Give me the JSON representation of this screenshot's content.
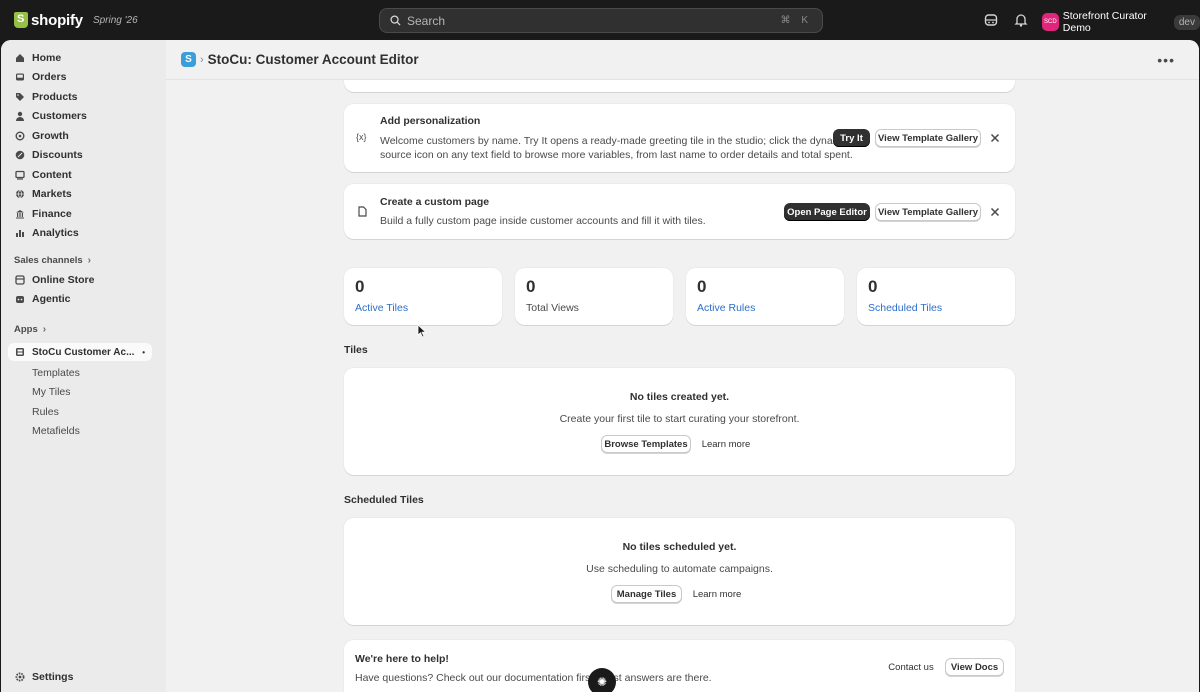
{
  "topbar": {
    "brand": "shopify",
    "version": "Spring '26",
    "search_placeholder": "Search",
    "search_shortcut": "⌘ K",
    "store_initials": "SCD",
    "store_name": "Storefront Curator Demo",
    "store_badge": "dev"
  },
  "sidebar": {
    "items": [
      {
        "label": "Home",
        "icon": "home-icon"
      },
      {
        "label": "Orders",
        "icon": "orders-icon"
      },
      {
        "label": "Products",
        "icon": "tag-icon"
      },
      {
        "label": "Customers",
        "icon": "person-icon"
      },
      {
        "label": "Growth",
        "icon": "growth-icon"
      },
      {
        "label": "Discounts",
        "icon": "discount-icon"
      },
      {
        "label": "Content",
        "icon": "content-icon"
      },
      {
        "label": "Markets",
        "icon": "globe-icon"
      },
      {
        "label": "Finance",
        "icon": "bank-icon"
      },
      {
        "label": "Analytics",
        "icon": "bar-chart-icon"
      }
    ],
    "sales_channels_label": "Sales channels",
    "channels": [
      {
        "label": "Online Store",
        "icon": "store-icon"
      },
      {
        "label": "Agentic",
        "icon": "agent-icon"
      }
    ],
    "apps_label": "Apps",
    "app_name": "StoCu Customer Ac...",
    "app_subitems": [
      "Templates",
      "My Tiles",
      "Rules",
      "Metafields"
    ],
    "settings_label": "Settings"
  },
  "page": {
    "title": "StoCu: Customer Account Editor",
    "more_label": "•••"
  },
  "personalization": {
    "icon": "{x}",
    "title": "Add personalization",
    "desc_line1": "Welcome customers by name. Try It opens a ready-made greeting tile in the studio; click the dynamic",
    "desc_line2": "source icon on any text field to browse more variables, from last name to order details and total spent.",
    "primary": "Try It",
    "secondary": "View Template Gallery"
  },
  "custom_page": {
    "title": "Create a custom page",
    "desc": "Build a fully custom page inside customer accounts and fill it with tiles.",
    "primary": "Open Page Editor",
    "secondary": "View Template Gallery"
  },
  "stats": [
    {
      "value": "0",
      "label": "Active Tiles"
    },
    {
      "value": "0",
      "label": "Total Views"
    },
    {
      "value": "0",
      "label": "Active Rules"
    },
    {
      "value": "0",
      "label": "Scheduled Tiles"
    }
  ],
  "tiles": {
    "heading": "Tiles",
    "empty_title": "No tiles created yet.",
    "empty_desc": "Create your first tile to start curating your storefront.",
    "primary": "Browse Templates",
    "secondary": "Learn more"
  },
  "scheduled": {
    "heading": "Scheduled Tiles",
    "empty_title": "No tiles scheduled yet.",
    "empty_desc": "Use scheduling to automate campaigns.",
    "primary": "Manage Tiles",
    "secondary": "Learn more"
  },
  "help": {
    "title": "We're here to help!",
    "desc": "Have questions? Check out our documentation first. Most answers are there.",
    "contact": "Contact us",
    "docs": "View Docs"
  },
  "colors": {
    "link": "#2c6ecb",
    "primary_button": "#303030",
    "avatar": "#e0267a",
    "app_logo": "#3a9fd8"
  }
}
